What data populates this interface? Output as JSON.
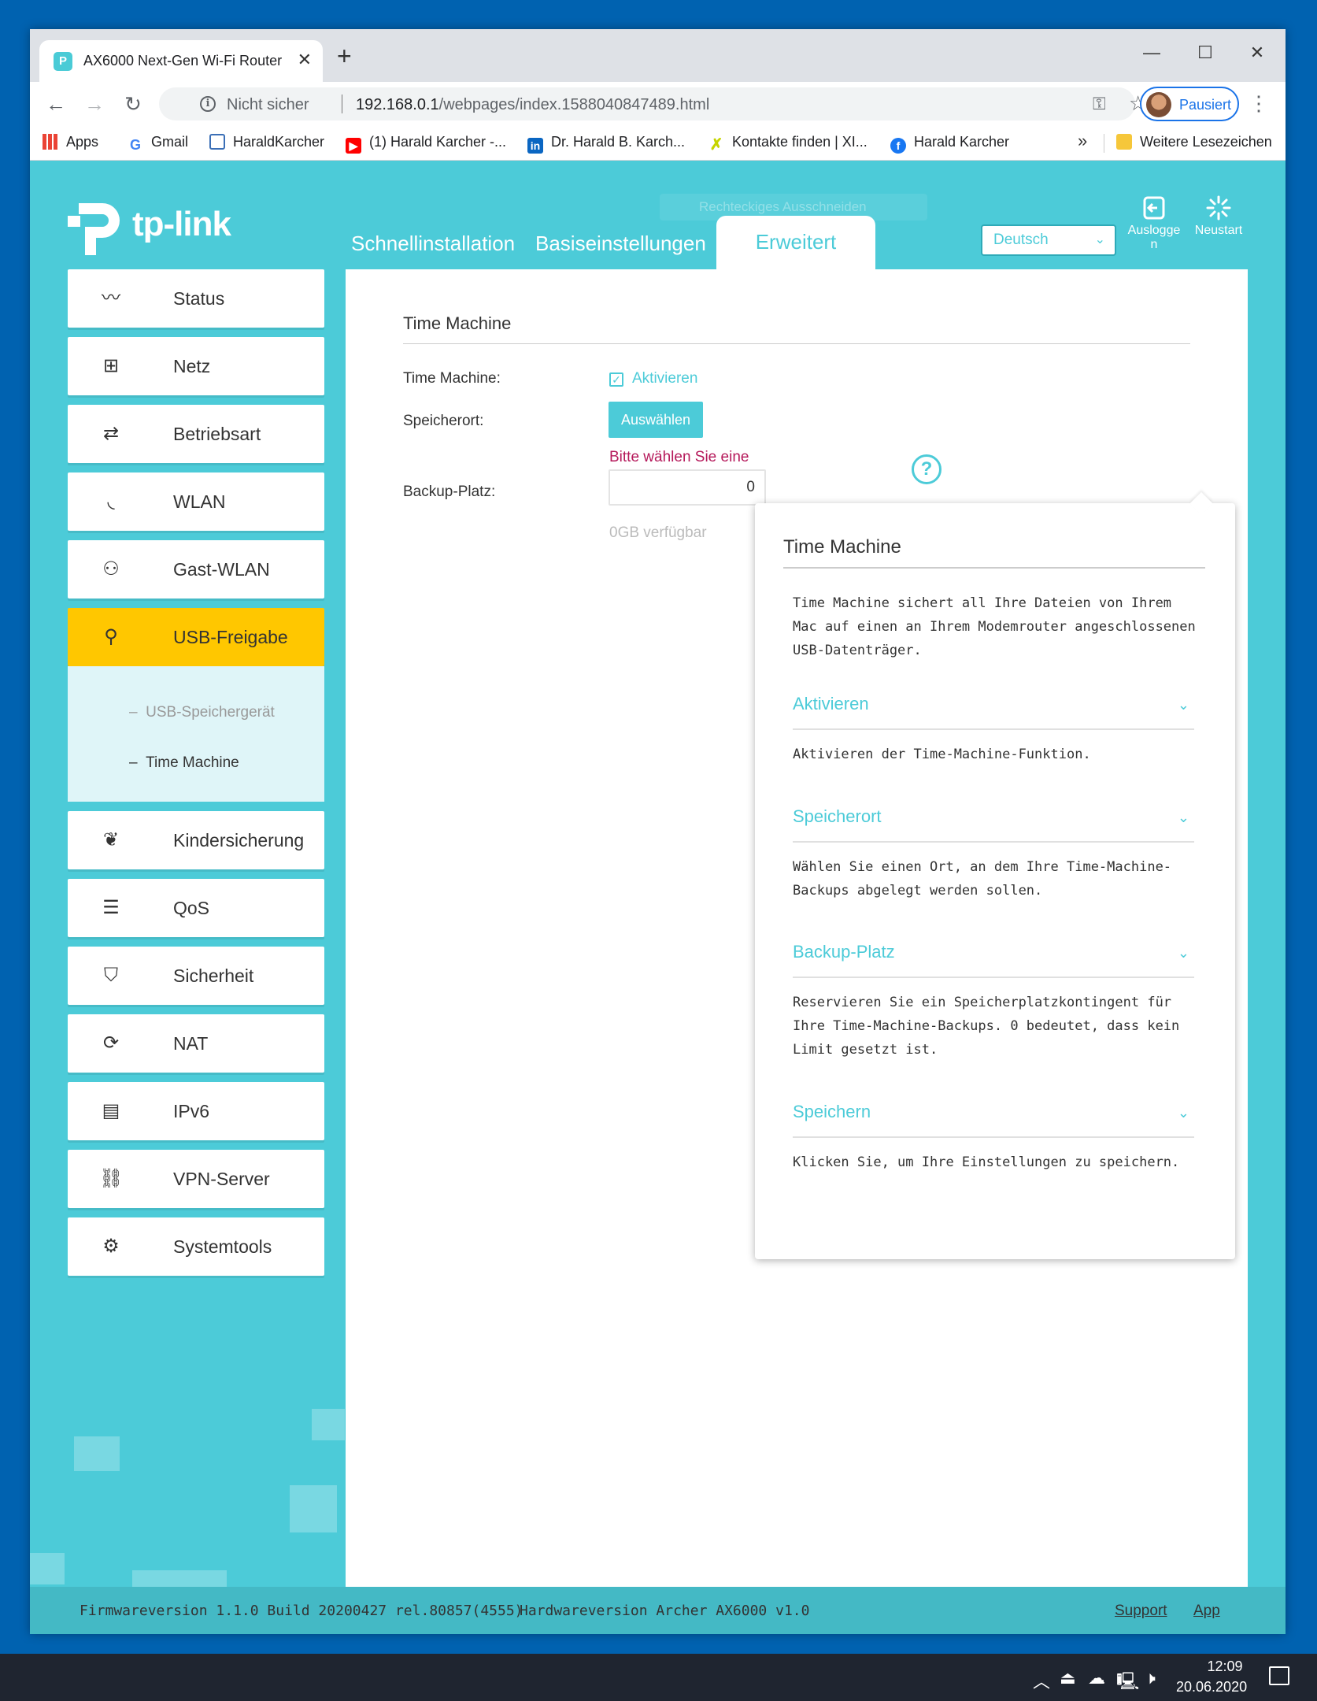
{
  "browser": {
    "tab_title": "AX6000 Next-Gen Wi-Fi Router",
    "security_label": "Nicht sicher",
    "url_host": "192.168.0.1",
    "url_path": "/webpages/index.1588040847489.html",
    "profile_label": "Pausiert",
    "bookmarks": [
      "Apps",
      "Gmail",
      "HaraldKarcher",
      "(1) Harald Karcher -...",
      "Dr. Harald B. Karch...",
      "Kontakte finden | XI...",
      "Harald Karcher"
    ],
    "bookmarks_more": "»",
    "bookmarks_folder": "Weitere Lesezeichen"
  },
  "router": {
    "logo_text": "tp-link",
    "ghost_text": "Rechteckiges Ausschneiden",
    "nav": {
      "quick": "Schnellinstallation",
      "basic": "Basiseinstellungen",
      "advanced": "Erweitert"
    },
    "language": "Deutsch",
    "logout_label": "Auslogge n",
    "reboot_label": "Neustart",
    "sidebar": [
      "Status",
      "Netz",
      "Betriebsart",
      "WLAN",
      "Gast-WLAN",
      "USB-Freigabe",
      "Kindersicherung",
      "QoS",
      "Sicherheit",
      "NAT",
      "IPv6",
      "VPN-Server",
      "Systemtools"
    ],
    "submenu": [
      "USB-Speichergerät",
      "Time Machine"
    ],
    "form": {
      "title": "Time Machine",
      "tm_label": "Time Machine:",
      "enable_label": "Aktivieren",
      "enable_checked": true,
      "store_label": "Speicherort:",
      "select_button": "Auswählen",
      "store_error": "Bitte wählen Sie eine",
      "backup_label": "Backup-Platz:",
      "backup_value": "0",
      "available": "0GB verfügbar"
    },
    "help": {
      "title": "Time Machine",
      "intro": "Time Machine sichert all Ihre Dateien von Ihrem Mac auf einen an Ihrem Modemrouter angeschlossenen USB-Datenträger.",
      "sections": [
        {
          "heading": "Aktivieren",
          "text": "Aktivieren der Time-Machine-Funktion."
        },
        {
          "heading": "Speicherort",
          "text": "Wählen Sie einen Ort, an dem Ihre Time-Machine-Backups abgelegt werden sollen."
        },
        {
          "heading": "Backup-Platz",
          "text": "Reservieren Sie ein Speicherplatzkontingent für Ihre Time-Machine-Backups. 0 bedeutet, dass kein Limit gesetzt ist."
        },
        {
          "heading": "Speichern",
          "text": "Klicken Sie, um Ihre Einstellungen zu speichern."
        }
      ]
    },
    "footer": {
      "firmware": "Firmwareversion 1.1.0 Build 20200427 rel.80857(4555)",
      "hardware": "Hardwareversion Archer AX6000 v1.0",
      "support": "Support",
      "app": "App"
    }
  },
  "taskbar": {
    "time": "12:09",
    "date": "20.06.2020"
  },
  "colors": {
    "brand": "#4ccbd8",
    "active_nav": "#ffc700",
    "error": "#b5185a"
  }
}
